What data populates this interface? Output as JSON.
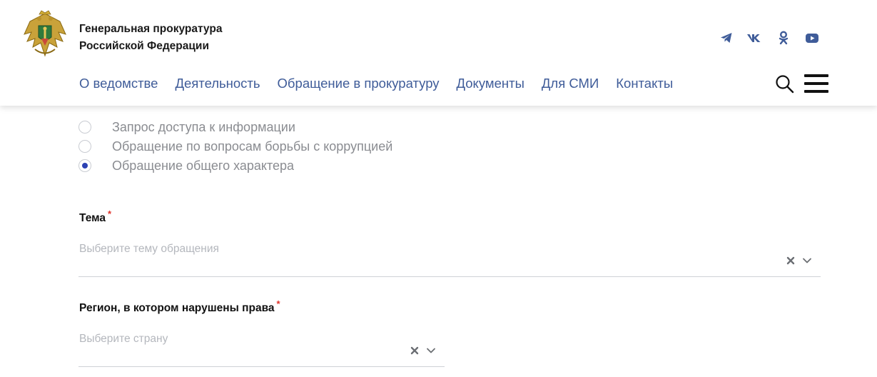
{
  "header": {
    "org_name_line1": "Генеральная прокуратура",
    "org_name_line2": "Российской Федерации",
    "social": [
      "telegram-icon",
      "vk-icon",
      "odnoklassniki-icon",
      "youtube-icon"
    ],
    "nav": [
      "О ведомстве",
      "Деятельность",
      "Обращение в прокуратуру",
      "Документы",
      "Для СМИ",
      "Контакты"
    ],
    "accent_color": "#3f5c99"
  },
  "form": {
    "appeal_types": [
      {
        "label": "Запрос доступа к информации",
        "checked": false
      },
      {
        "label": "Обращение по вопросам борьбы с коррупцией",
        "checked": false
      },
      {
        "label": "Обращение общего характера",
        "checked": true
      }
    ],
    "topic": {
      "label": "Тема",
      "required_mark": "*",
      "placeholder": "Выберите тему обращения"
    },
    "region": {
      "label": "Регион, в котором нарушены права",
      "required_mark": "*",
      "placeholder": "Выберите страну"
    }
  }
}
